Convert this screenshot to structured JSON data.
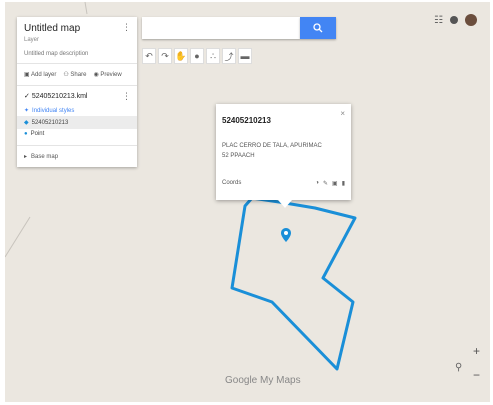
{
  "search": {
    "value": "",
    "placeholder": ""
  },
  "panel": {
    "map_title": "Untitled map",
    "map_subtitle": "Layer",
    "map_description": "Untitled map description",
    "actions": {
      "add_layer": "Add layer",
      "share": "Share",
      "preview": "Preview"
    },
    "layer_title": "52405210213.kml",
    "individual_styles": "Individual styles",
    "feature_selected": "52405210213",
    "feature_point": "Point",
    "base_map": "Base map"
  },
  "popup": {
    "title": "52405210213",
    "address_line1": "PLAC CERRO DE TALA, APURIMAC",
    "address_line2": "52 PPAACH",
    "coords": "Coords"
  },
  "brand": {
    "google": "Google",
    "my_maps": "My Maps"
  },
  "colors": {
    "polygon": "#1a8fd8",
    "accent": "#4285f4",
    "map_bg": "#ebe7e0"
  },
  "icons": {
    "search": "search-icon",
    "apps": "apps-grid-icon",
    "notifications": "notifications-icon",
    "avatar": "avatar",
    "pin": "map-pin-icon",
    "zoom_in": "zoom-in-icon",
    "zoom_out": "zoom-out-icon",
    "pegman": "pegman-icon"
  }
}
